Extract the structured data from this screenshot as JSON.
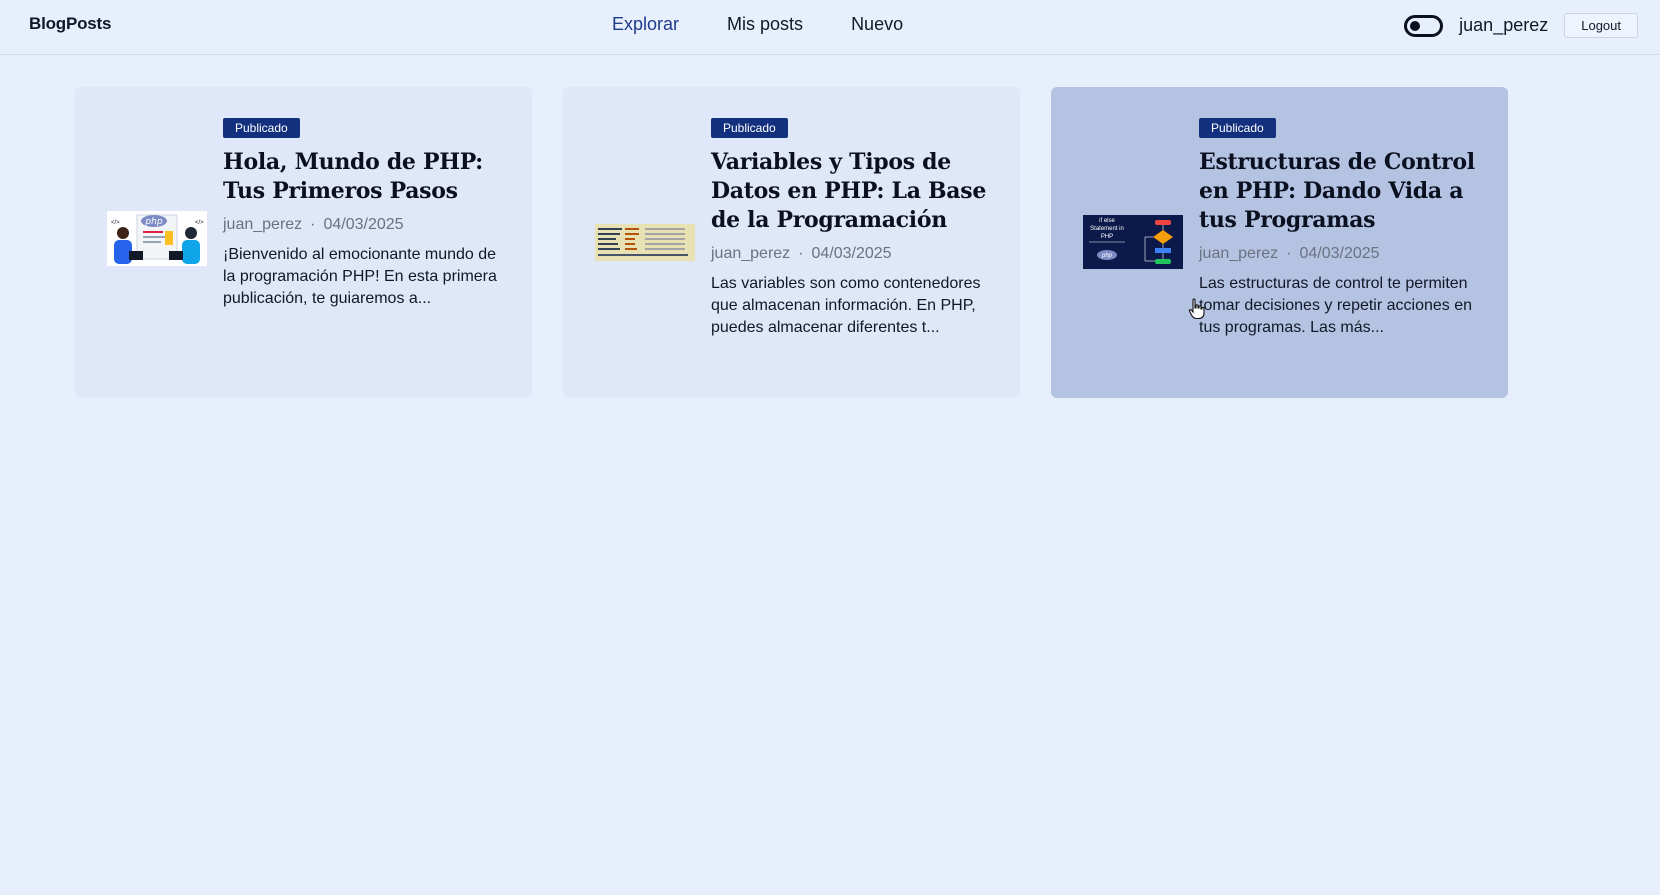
{
  "header": {
    "brand": "BlogPosts",
    "nav": [
      "Explorar",
      "Mis posts",
      "Nuevo"
    ],
    "username": "juan_perez",
    "logout_label": "Logout"
  },
  "posts": [
    {
      "badge": "Publicado",
      "title": "Hola, Mundo de PHP: Tus Primeros Pasos",
      "author": "juan_perez",
      "separator": "·",
      "date": "04/03/2025",
      "excerpt": "¡Bienvenido al emocionante mundo de la programación PHP! En esta primera publicación, te guiaremos a...",
      "thumbnail_icon": "php-developers-illustration-icon",
      "thumb_text": "php"
    },
    {
      "badge": "Publicado",
      "title": "Variables y Tipos de Datos en PHP: La Base de la Programación",
      "author": "juan_perez",
      "separator": "·",
      "date": "04/03/2025",
      "excerpt": "Las variables son como contenedores que almacenan información. En PHP, puedes almacenar diferentes t...",
      "thumbnail_icon": "php-code-snippet-icon"
    },
    {
      "badge": "Publicado",
      "title": "Estructuras de Control en PHP: Dando Vida a tus Programas",
      "author": "juan_perez",
      "separator": "·",
      "date": "04/03/2025",
      "excerpt": "Las estructuras de control te permiten tomar decisiones y repetir acciones en tus programas. Las más...",
      "thumbnail_icon": "php-flowchart-icon",
      "thumb_text_1": "if else",
      "thumb_text_2": "Statement in",
      "thumb_text_3": "PHP",
      "thumb_text_4": "php"
    }
  ],
  "colors": {
    "background": "#e8effc",
    "card": "#dfe7f8",
    "card_hover": "#b4c3e2",
    "badge": "#13307e",
    "nav_active": "#1e3a8a"
  }
}
